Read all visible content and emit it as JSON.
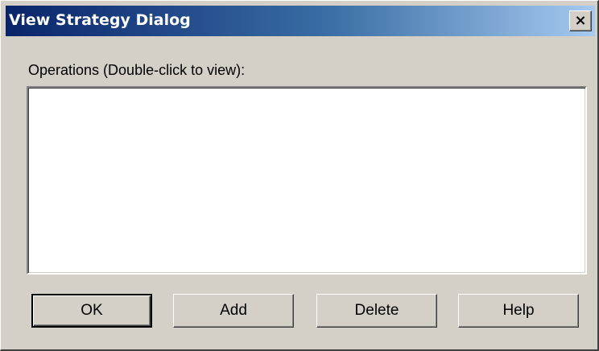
{
  "window": {
    "title": "View Strategy Dialog",
    "close_glyph": "×",
    "close_icon": "close-icon"
  },
  "operations": {
    "label": "Operations (Double-click to view):",
    "items": []
  },
  "buttons": {
    "ok": "OK",
    "add": "Add",
    "delete": "Delete",
    "help": "Help"
  },
  "colors": {
    "face": "#d4d0c8",
    "title_start": "#0a246a",
    "title_end": "#a6caf0",
    "list_bg": "#ffffff"
  }
}
